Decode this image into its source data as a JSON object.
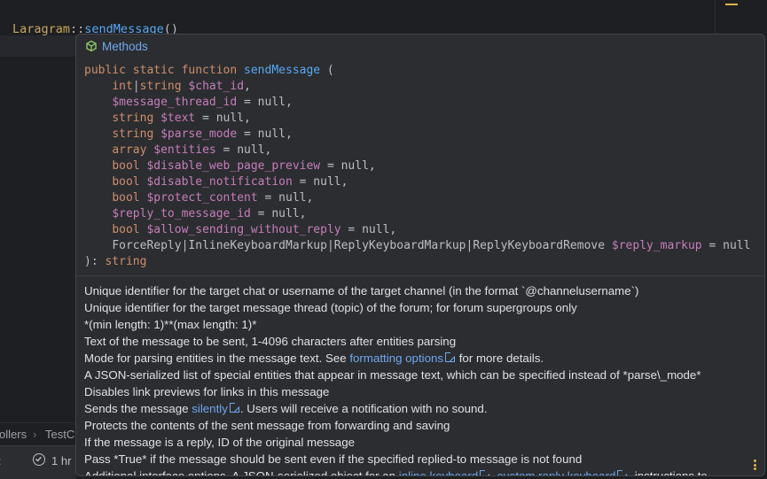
{
  "editor": {
    "class_name": "Laragram",
    "separator": "::",
    "method_name": "sendMessage",
    "parens": "()"
  },
  "breadcrumb": {
    "item1": "ollers",
    "sep": "›",
    "item2": "TestC"
  },
  "status": {
    "time_label": "1 hr"
  },
  "popup": {
    "header_label": "Methods",
    "signature": {
      "modifiers": "public static function",
      "name": "sendMessage",
      "open": " (",
      "params": [
        {
          "type": "int|string",
          "var": "$chat_id",
          "default": ","
        },
        {
          "type": "",
          "var": "$message_thread_id",
          "default": " = null,"
        },
        {
          "type": "string",
          "var": "$text",
          "default": " = null,"
        },
        {
          "type": "string",
          "var": "$parse_mode",
          "default": " = null,"
        },
        {
          "type": "array",
          "var": "$entities",
          "default": " = null,"
        },
        {
          "type": "bool",
          "var": "$disable_web_page_preview",
          "default": " = null,"
        },
        {
          "type": "bool",
          "var": "$disable_notification",
          "default": " = null,"
        },
        {
          "type": "bool",
          "var": "$protect_content",
          "default": " = null,"
        },
        {
          "type": "",
          "var": "$reply_to_message_id",
          "default": " = null,"
        },
        {
          "type": "bool",
          "var": "$allow_sending_without_reply",
          "default": " = null,"
        },
        {
          "type": "ForceReply|InlineKeyboardMarkup|ReplyKeyboardMarkup|ReplyKeyboardRemove",
          "var": "$reply_markup",
          "default": " = null"
        }
      ],
      "close": "): ",
      "return_type": "string"
    },
    "docs": {
      "line1": "Unique identifier for the target chat or username of the target channel (in the format `@channelusername`)",
      "line2": "Unique identifier for the target message thread (topic) of the forum; for forum supergroups only",
      "line3": "*(min length: 1)**(max length: 1)*",
      "line4": "Text of the message to be sent, 1-4096 characters after entities parsing",
      "line5_pre": "Mode for parsing entities in the message text. See ",
      "line5_link": "formatting options",
      "line5_post": " for more details.",
      "line6": "A JSON-serialized list of special entities that appear in message text, which can be specified instead of *parse\\_mode*",
      "line7": "Disables link previews for links in this message",
      "line8_pre": "Sends the message ",
      "line8_link": "silently",
      "line8_post": ". Users will receive a notification with no sound.",
      "line9": "Protects the contents of the sent message from forwarding and saving",
      "line10": "If the message is a reply, ID of the original message",
      "line11": "Pass *True* if the message should be sent even if the specified replied-to message is not found",
      "line12_pre": "Additional interface options. A JSON-serialized object for an ",
      "line12_link1": "inline keyboard",
      "line12_mid": ", ",
      "line12_link2": "custom reply keyboard",
      "line12_post": ", instructions to"
    }
  },
  "colors": {
    "keyword": "#cf8e6d",
    "function": "#56a8f5",
    "variable": "#c77dbb",
    "link": "#6fa8f0",
    "background": "#2b2d30"
  }
}
